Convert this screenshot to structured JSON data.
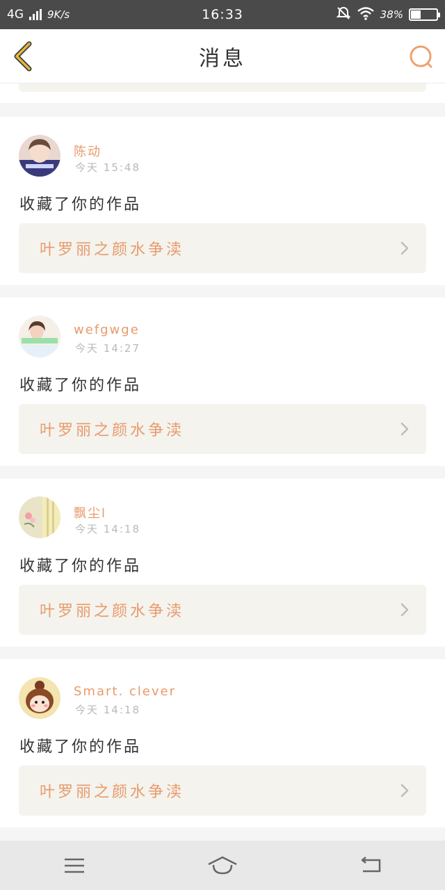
{
  "status_bar": {
    "network": "4G",
    "speed": "9K/s",
    "time": "16:33",
    "battery": "38%",
    "battery_level": 0.38
  },
  "header": {
    "title": "消息"
  },
  "colors": {
    "accent": "#e89a6b",
    "back_icon": "#e3b83a",
    "card_link_bg": "#f4f3ee"
  },
  "messages": [
    {
      "user": "陈动",
      "time": "今天 15:48",
      "action": "收藏了你的作品",
      "work_title": "叶罗丽之颜水争渎",
      "avatar": "girl-photo-avatar"
    },
    {
      "user": "wefgwge",
      "time": "今天 14:27",
      "action": "收藏了你的作品",
      "work_title": "叶罗丽之颜水争渎",
      "avatar": "girl-photo-avatar"
    },
    {
      "user": "飘尘l",
      "time": "今天 14:18",
      "action": "收藏了你的作品",
      "work_title": "叶罗丽之颜水争渎",
      "avatar": "floral-avatar"
    },
    {
      "user": "Smart. clever",
      "time": "今天 14:18",
      "action": "收藏了你的作品",
      "work_title": "叶罗丽之颜水争渎",
      "avatar": "cartoon-avatar"
    }
  ],
  "nav": {
    "menu": "menu-icon",
    "home": "home-icon",
    "back": "back-icon"
  }
}
